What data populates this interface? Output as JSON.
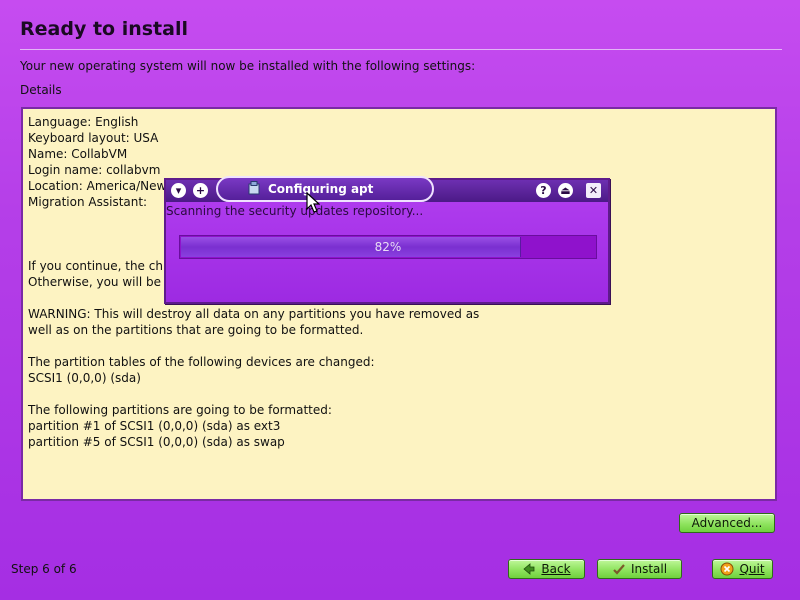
{
  "page": {
    "title": "Ready to install",
    "subtitle": "Your new operating system will now be installed with the following settings:",
    "details_label": "Details"
  },
  "details": {
    "lines": [
      "Language: English",
      "Keyboard layout: USA",
      "Name: CollabVM",
      "Login name: collabvm",
      "Location: America/New",
      "Migration Assistant:",
      "",
      "",
      "",
      "If you continue, the ch",
      "Otherwise, you will be",
      "",
      "WARNING: This will destroy all data on any partitions you have removed as",
      "well as on the partitions that are going to be formatted.",
      "",
      "The partition tables of the following devices are changed:",
      "SCSI1 (0,0,0) (sda)",
      "",
      "The following partitions are going to be formatted:",
      "partition #1 of SCSI1 (0,0,0) (sda) as ext3",
      "partition #5 of SCSI1 (0,0,0) (sda) as swap"
    ]
  },
  "dialog": {
    "title": "Configuring apt",
    "status_text": "Scanning the security updates repository...",
    "progress_fraction": 0.82,
    "progress_label": "82%",
    "window_buttons": {
      "menu": "menu-icon",
      "pin": "pin-icon",
      "help": "help-icon",
      "shade": "shade-icon",
      "close": "close-icon"
    }
  },
  "footer": {
    "step_text": "Step 6 of 6",
    "advanced_label": "Advanced...",
    "back_label": "Back",
    "install_label": "Install",
    "quit_label": "Quit"
  },
  "colors": {
    "background": "#b53fe8",
    "details_background": "#fdf3c2",
    "button_green": "#8fe35f",
    "progress_track": "#8f12cc"
  }
}
